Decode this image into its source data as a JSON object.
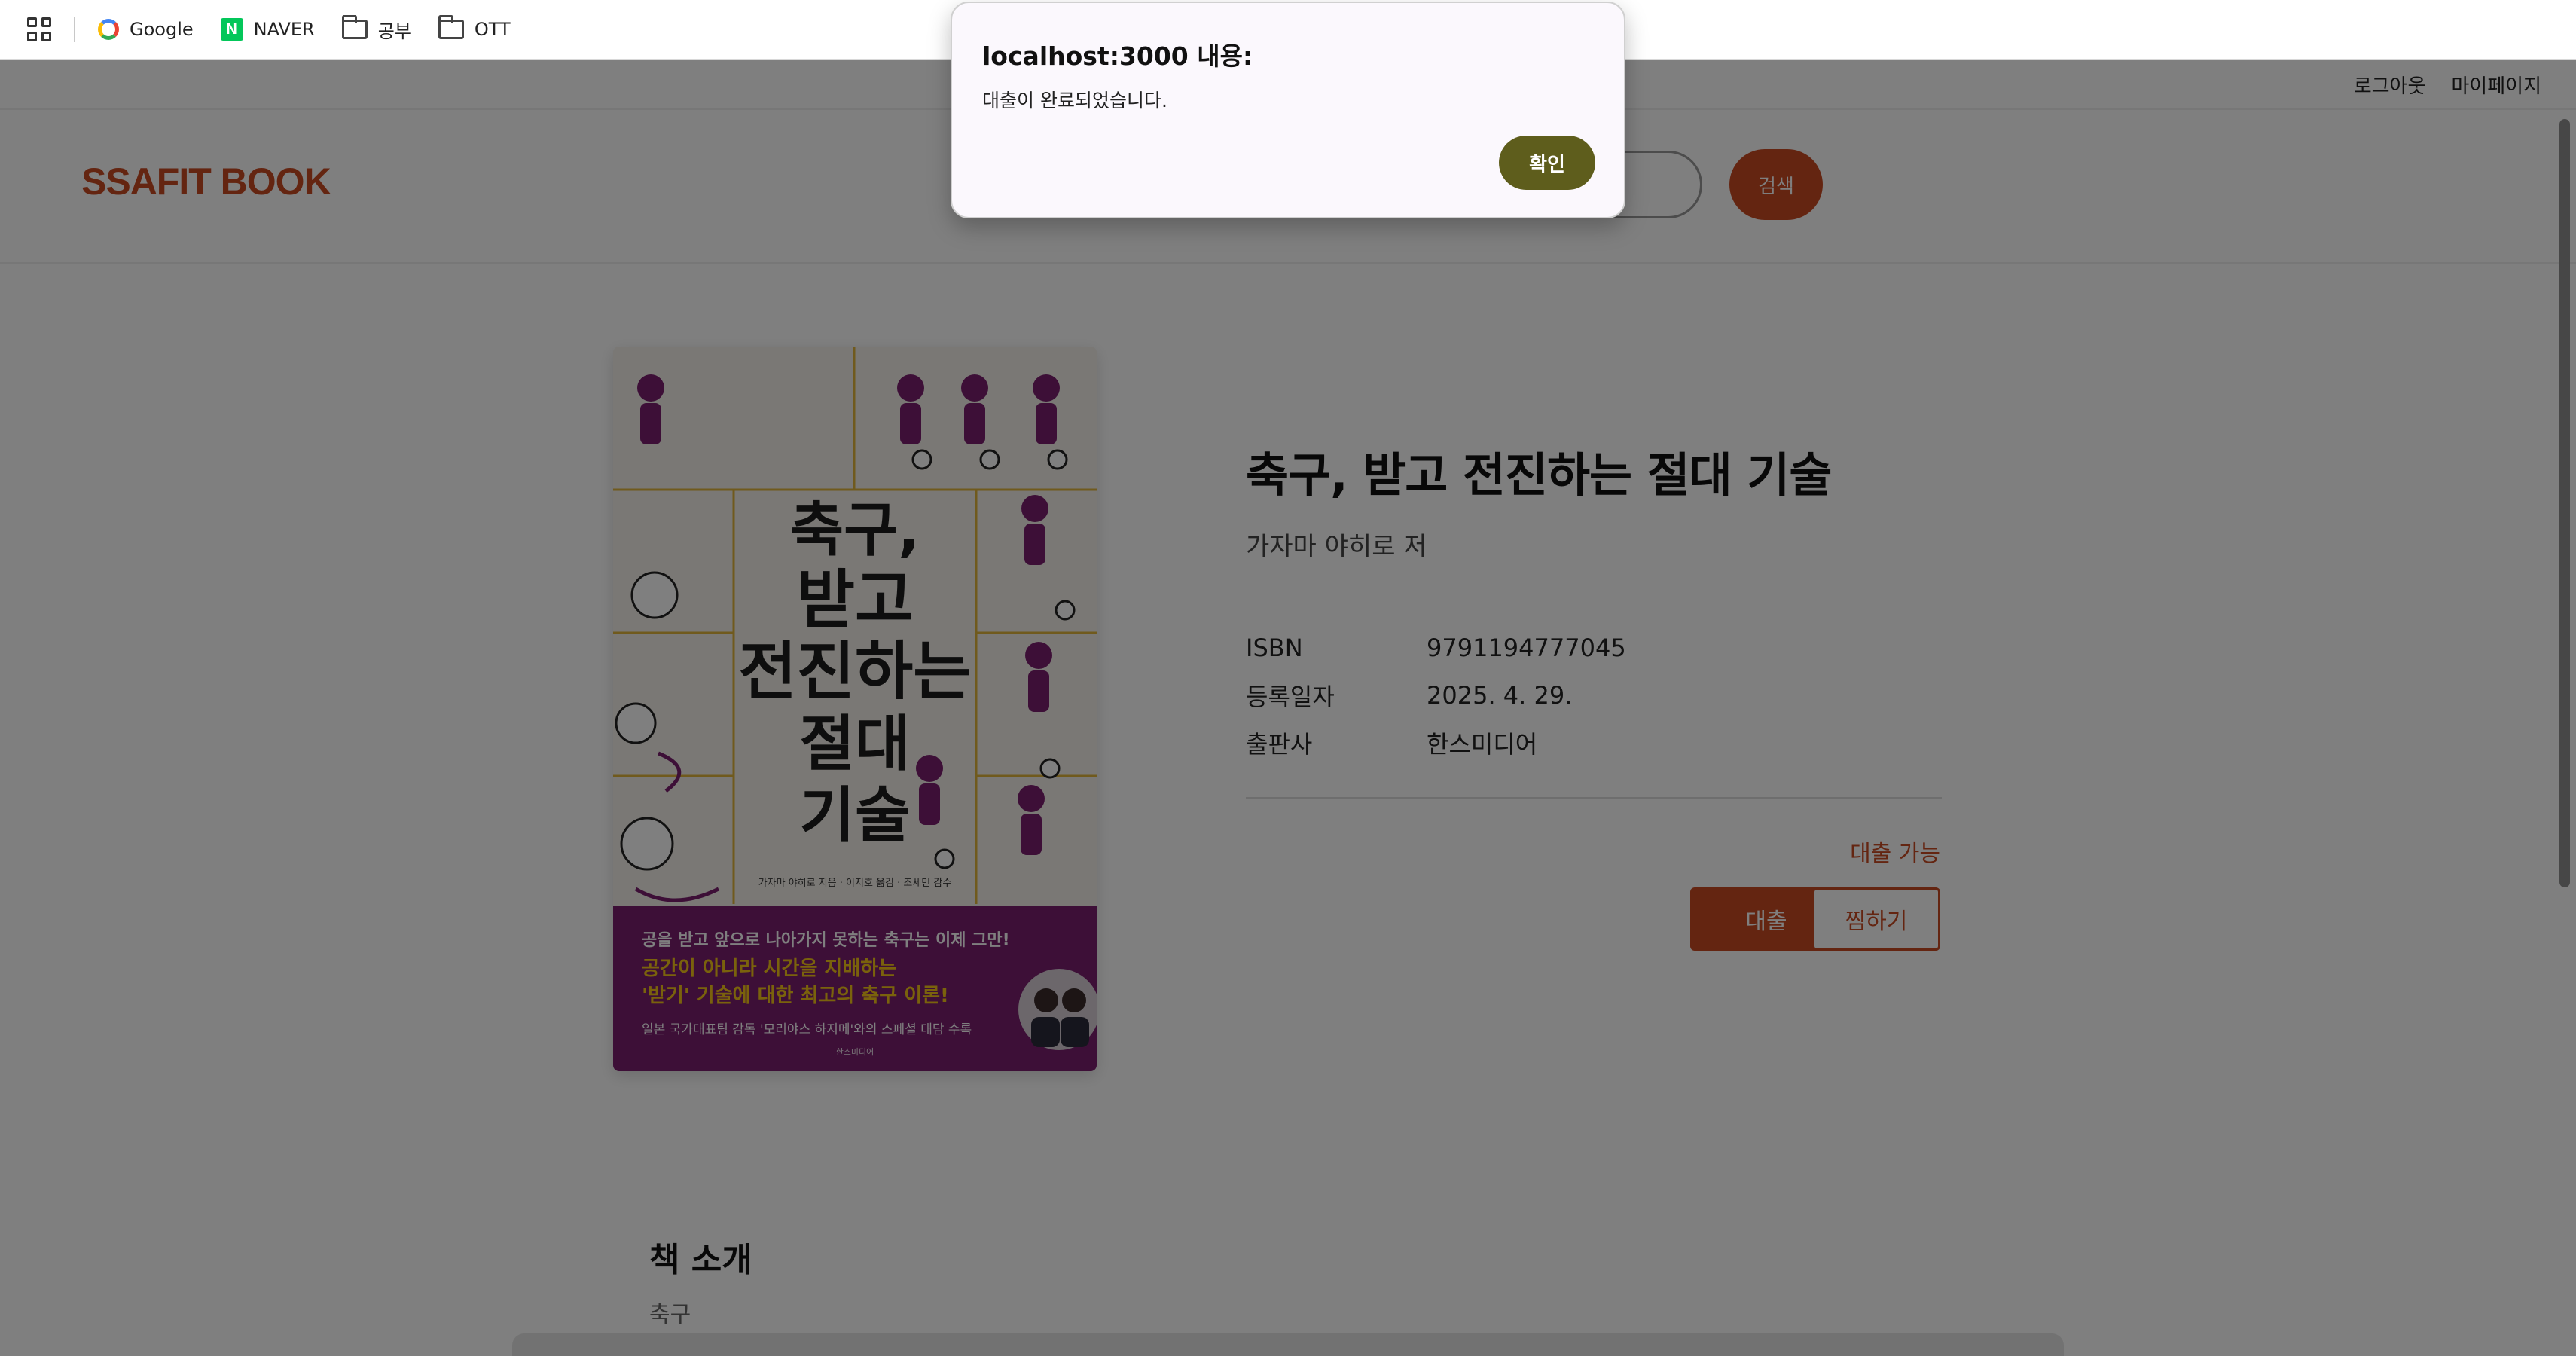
{
  "browser": {
    "bookmarks": [
      {
        "label": "Google",
        "icon": "google-icon"
      },
      {
        "label": "NAVER",
        "icon": "naver-icon"
      },
      {
        "label": "공부",
        "icon": "folder-icon"
      },
      {
        "label": "OTT",
        "icon": "folder-icon"
      }
    ]
  },
  "nav": {
    "logout": "로그아웃",
    "mypage": "마이페이지"
  },
  "header": {
    "logo": "SSAFIT BOOK",
    "search_button": "검색",
    "search_value": ""
  },
  "cover": {
    "title_lines": [
      "축구,",
      "받고",
      "전진하는",
      "절대",
      "기술"
    ],
    "authors_line": "가자마 야히로 지음 · 이지호 옮김 · 조세민 감수",
    "banner_lines": [
      "공을 받고 앞으로 나아가지 못하는 축구는 이제 그만!",
      "공간이 아니라 시간을 지배하는",
      "'받기' 기술에 대한 최고의 축구 이론!",
      "일본 국가대표팀 감독 '모리야스 하지메'와의 스페셜 대담 수록"
    ],
    "publisher_small": "한스미디어"
  },
  "book": {
    "title": "축구, 받고 전진하는 절대 기술",
    "author": "가자마 야히로 저",
    "meta": [
      {
        "key": "ISBN",
        "value": "9791194777045"
      },
      {
        "key": "등록일자",
        "value": "2025. 4. 29."
      },
      {
        "key": "출판사",
        "value": "한스미디어"
      }
    ],
    "availability": "대출 가능",
    "borrow_button": "대출",
    "wish_button": "찜하기"
  },
  "intro": {
    "title": "책 소개",
    "text": "축구"
  },
  "dialog": {
    "title": "localhost:3000 내용:",
    "message": "대출이 완료되었습니다.",
    "ok_button": "확인"
  },
  "colors": {
    "accent": "#c94a23",
    "dialog_button": "#5e5d1c",
    "cover_banner": "#7a1f6f",
    "cover_highlight": "#f5c518"
  }
}
